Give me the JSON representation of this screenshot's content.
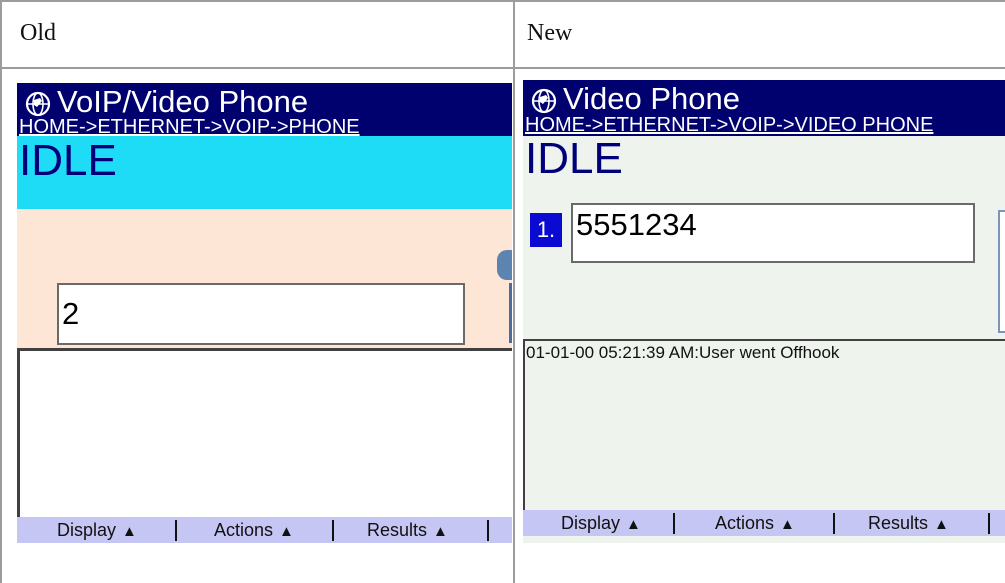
{
  "table": {
    "headers": [
      "Old",
      "New"
    ]
  },
  "old": {
    "title": "VoIP/Video Phone",
    "breadcrumb": "HOME->ETHERNET->VOIP->PHONE",
    "status": "IDLE",
    "input_value": "2",
    "log_text": "",
    "menu": [
      "Display",
      "Actions",
      "Results"
    ],
    "icon": "globe-phone-icon",
    "colors": {
      "titlebar": "#00006e",
      "status_bg": "#1fdcf6",
      "body_bg": "#fde6d6",
      "menubar": "#c6c6f5"
    }
  },
  "new": {
    "title": "Video Phone",
    "breadcrumb": "HOME->ETHERNET->VOIP->VIDEO PHONE",
    "status": "IDLE",
    "line_number": "1.",
    "input_value": "5551234",
    "log_text": "01-01-00 05:21:39 AM:User went Offhook",
    "menu": [
      "Display",
      "Actions",
      "Results"
    ],
    "icon": "globe-phone-icon",
    "colors": {
      "titlebar": "#00006e",
      "status_bg": "#eef3ee",
      "body_bg": "#eef3ee",
      "menubar": "#c6c6f5",
      "line_badge": "#0a0ad2"
    }
  },
  "menu_arrow": "▲"
}
